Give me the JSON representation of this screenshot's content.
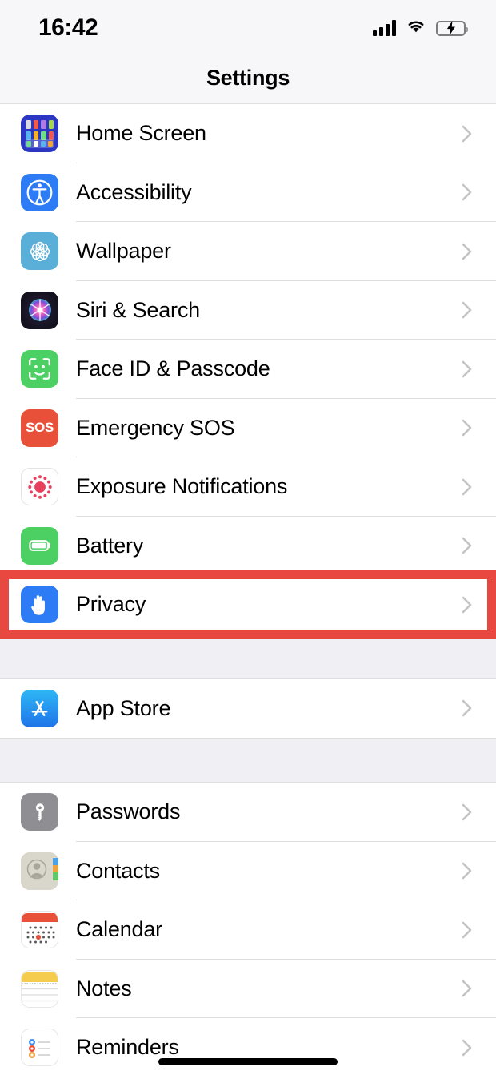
{
  "status_bar": {
    "time": "16:42",
    "signal_icon": "cellular-signal-icon",
    "wifi_icon": "wifi-icon",
    "battery_icon": "battery-charging-icon",
    "battery_level_percent": 42,
    "battery_charging": true
  },
  "nav": {
    "title": "Settings"
  },
  "colors": {
    "highlight": "#e8483f",
    "separator": "#dededf",
    "group_gap": "#f0f0f4",
    "status_bg": "#f7f7f9",
    "chevron": "#c4c4c6"
  },
  "groups": [
    {
      "id": "group-1",
      "rows": [
        {
          "label": "Home Screen",
          "icon": "home-screen-icon",
          "chevron": "chevron-right-icon",
          "highlighted": false
        },
        {
          "label": "Accessibility",
          "icon": "accessibility-icon",
          "chevron": "chevron-right-icon",
          "highlighted": false
        },
        {
          "label": "Wallpaper",
          "icon": "wallpaper-icon",
          "chevron": "chevron-right-icon",
          "highlighted": false
        },
        {
          "label": "Siri & Search",
          "icon": "siri-icon",
          "chevron": "chevron-right-icon",
          "highlighted": false
        },
        {
          "label": "Face ID & Passcode",
          "icon": "face-id-icon",
          "chevron": "chevron-right-icon",
          "highlighted": false
        },
        {
          "label": "Emergency SOS",
          "icon": "emergency-sos-icon",
          "chevron": "chevron-right-icon",
          "highlighted": false
        },
        {
          "label": "Exposure Notifications",
          "icon": "exposure-notifications-icon",
          "chevron": "chevron-right-icon",
          "highlighted": false
        },
        {
          "label": "Battery",
          "icon": "battery-settings-icon",
          "chevron": "chevron-right-icon",
          "highlighted": false
        },
        {
          "label": "Privacy",
          "icon": "privacy-hand-icon",
          "chevron": "chevron-right-icon",
          "highlighted": true
        }
      ]
    },
    {
      "id": "group-2",
      "rows": [
        {
          "label": "App Store",
          "icon": "app-store-icon",
          "chevron": "chevron-right-icon",
          "highlighted": false
        }
      ]
    },
    {
      "id": "group-3",
      "rows": [
        {
          "label": "Passwords",
          "icon": "passwords-key-icon",
          "chevron": "chevron-right-icon",
          "highlighted": false
        },
        {
          "label": "Contacts",
          "icon": "contacts-icon",
          "chevron": "chevron-right-icon",
          "highlighted": false
        },
        {
          "label": "Calendar",
          "icon": "calendar-icon",
          "chevron": "chevron-right-icon",
          "highlighted": false
        },
        {
          "label": "Notes",
          "icon": "notes-icon",
          "chevron": "chevron-right-icon",
          "highlighted": false
        },
        {
          "label": "Reminders",
          "icon": "reminders-icon",
          "chevron": "chevron-right-icon",
          "highlighted": false
        }
      ]
    }
  ],
  "sos_icon_text": "SOS",
  "home_indicator": "home-indicator"
}
